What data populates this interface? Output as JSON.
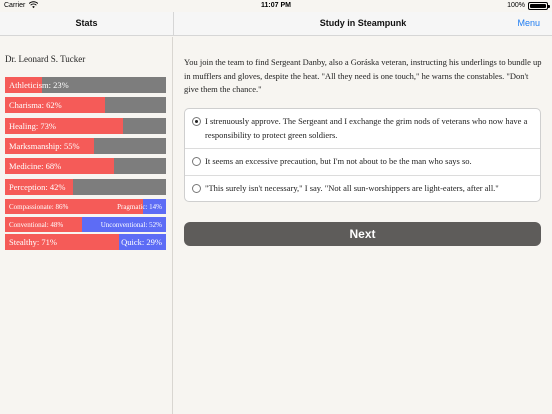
{
  "status_bar": {
    "carrier": "Carrier",
    "time": "11:07 PM",
    "battery": "100%"
  },
  "nav": {
    "left_title": "Stats",
    "title": "Study in Steampunk",
    "menu_label": "Menu"
  },
  "sidebar": {
    "character_name": "Dr. Leonard S. Tucker",
    "stats": [
      {
        "label": "Athleticism: 23%",
        "value": 23
      },
      {
        "label": "Charisma: 62%",
        "value": 62
      },
      {
        "label": "Healing: 73%",
        "value": 73
      },
      {
        "label": "Marksmanship: 55%",
        "value": 55
      },
      {
        "label": "Medicine: 68%",
        "value": 68
      },
      {
        "label": "Perception: 42%",
        "value": 42
      }
    ],
    "opposed": [
      {
        "left": "Compassionate: 86%",
        "right": "Pragmatic: 14%",
        "value": 86
      },
      {
        "left": "Conventional: 48%",
        "right": "Unconventional: 52%",
        "value": 48
      },
      {
        "left": "Stealthy: 71%",
        "right": "Quick: 29%",
        "value": 71
      }
    ]
  },
  "story": {
    "text": "You join the team to find Sergeant Danby, also a Goráska veteran, instructing his underlings to bundle up in mufflers and gloves, despite the heat. \"All they need is one touch,\" he warns the constables. \"Don't give them the chance.\""
  },
  "choices": [
    {
      "text": "I strenuously approve. The Sergeant and I exchange the grim nods of veterans who now have a responsibility to protect green soldiers.",
      "selected": true
    },
    {
      "text": "It seems an excessive precaution, but I'm not about to be the man who says so.",
      "selected": false
    },
    {
      "text": "\"This surely isn't necessary,\" I say. \"Not all sun-worshippers are light-eaters, after all.\"",
      "selected": false
    }
  ],
  "next_label": "Next",
  "colors": {
    "accent": "#1e7cf2",
    "bar_fill": "#f55b58",
    "bar_empty": "#7d7d7d",
    "opposed_right": "#5d6cf5",
    "button": "#5e5c5a"
  }
}
